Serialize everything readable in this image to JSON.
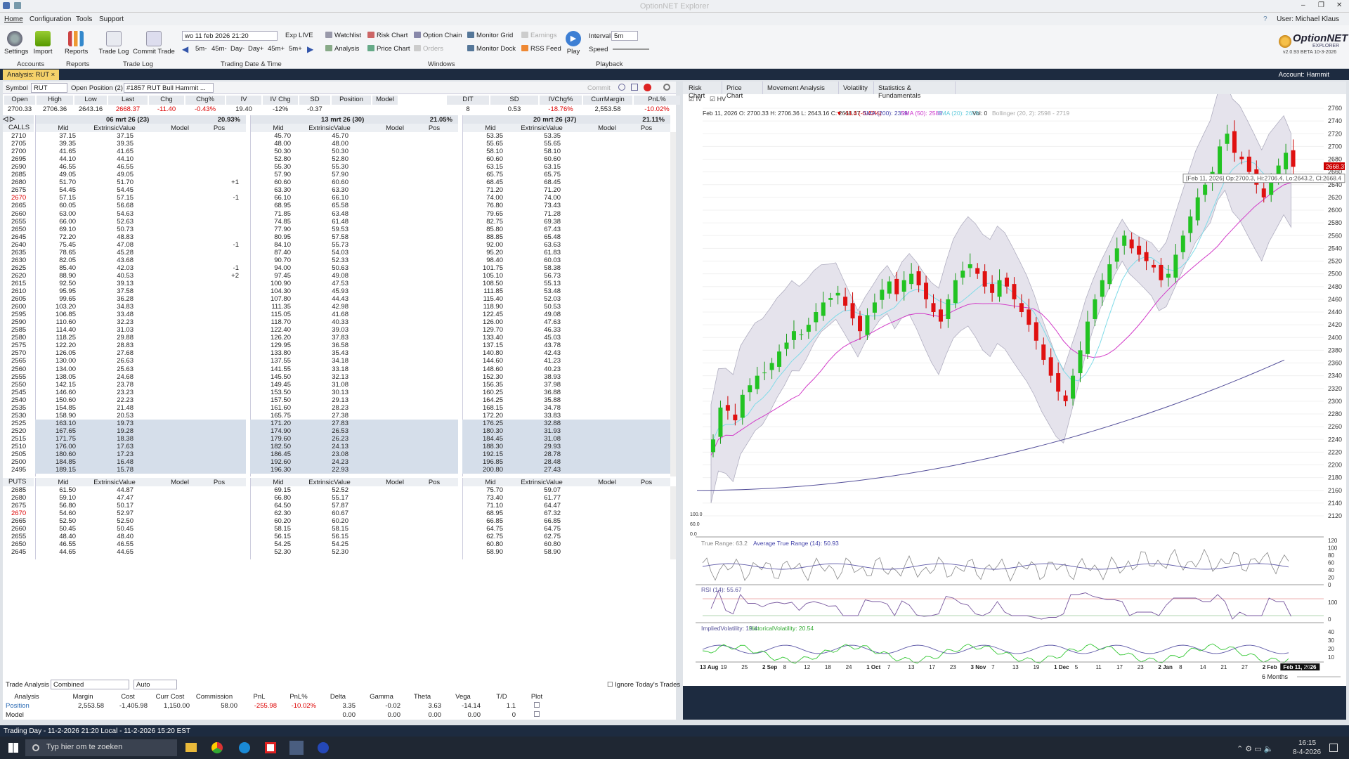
{
  "window": {
    "title": "OptionNET Explorer",
    "user": "User: Michael Klaus"
  },
  "menu": [
    "Home",
    "Configuration",
    "Tools",
    "Support"
  ],
  "ribbon": {
    "accounts": {
      "group": "Accounts",
      "buttons": [
        "Settings",
        "Import"
      ]
    },
    "reports": {
      "group": "Reports",
      "buttons": [
        "Reports"
      ]
    },
    "tradelog": {
      "group": "Trade Log",
      "buttons": [
        "Trade Log",
        "Commit Trade"
      ]
    },
    "datetime": {
      "group": "Trading Date & Time",
      "value": "wo 11 feb 2026 21:20",
      "exp": "Exp LIVE",
      "steps": [
        "5m-",
        "45m-",
        "Day-",
        "Day+",
        "45m+",
        "5m+"
      ]
    },
    "windows": {
      "group": "Windows",
      "items": [
        "Watchlist",
        "Risk Chart",
        "Option Chain",
        "Monitor Grid",
        "Earnings",
        "Analysis",
        "Price Chart",
        "Orders",
        "Monitor Dock",
        "RSS Feed"
      ]
    },
    "playback": {
      "group": "Playback",
      "play": "Play",
      "interval_label": "Interval",
      "interval": "5m",
      "speed_label": "Speed"
    },
    "logo": "OptionNET",
    "logo_sub": "EXPLORER",
    "version": "v2.0.93 BETA 10-3-2026"
  },
  "doctab": {
    "label": "Analysis: RUT",
    "account": "Account: Hammit"
  },
  "symbolbar": {
    "symbol_label": "Symbol",
    "symbol": "RUT",
    "open_label": "Open Position (2)",
    "position": "#1857 RUT Bull Hammit ...",
    "commit": "Commit"
  },
  "quote": {
    "headers": [
      "Open",
      "High",
      "Low",
      "Last",
      "Chg",
      "Chg%",
      "IV",
      "IV Chg",
      "SD",
      "Position",
      "Model"
    ],
    "values": [
      "2700.33",
      "2706.36",
      "2643.16",
      "2668.37",
      "-11.40",
      "-0.43%",
      "19.40",
      "-12%",
      "-0.37",
      "",
      ""
    ],
    "headers2": [
      "DIT",
      "SD",
      "IVChg%",
      "CurrMargin",
      "PnL%"
    ],
    "values2": [
      "8",
      "0.53",
      "-18.76%",
      "2,553.58",
      "-10.02%"
    ]
  },
  "expirations": [
    {
      "label": "06 mrt 26 (23)",
      "iv": "20.93%"
    },
    {
      "label": "13 mrt 26 (30)",
      "iv": "21.05%"
    },
    {
      "label": "20 mrt 26 (37)",
      "iv": "21.11%"
    }
  ],
  "chain_cols": [
    "Mid",
    "ExtrinsicValue",
    "Model",
    "Pos"
  ],
  "calls_label": "CALLS",
  "puts_label": "PUTS",
  "calls": [
    [
      "2710",
      "37.15",
      "37.15",
      "",
      "45.70",
      "45.70",
      "",
      "53.35",
      "53.35",
      ""
    ],
    [
      "2705",
      "39.35",
      "39.35",
      "",
      "48.00",
      "48.00",
      "",
      "55.65",
      "55.65",
      ""
    ],
    [
      "2700",
      "41.65",
      "41.65",
      "",
      "50.30",
      "50.30",
      "",
      "58.10",
      "58.10",
      ""
    ],
    [
      "2695",
      "44.10",
      "44.10",
      "",
      "52.80",
      "52.80",
      "",
      "60.60",
      "60.60",
      ""
    ],
    [
      "2690",
      "46.55",
      "46.55",
      "",
      "55.30",
      "55.30",
      "",
      "63.15",
      "63.15",
      ""
    ],
    [
      "2685",
      "49.05",
      "49.05",
      "",
      "57.90",
      "57.90",
      "",
      "65.75",
      "65.75",
      ""
    ],
    [
      "2680",
      "51.70",
      "51.70",
      "+1",
      "60.60",
      "60.60",
      "",
      "68.45",
      "68.45",
      ""
    ],
    [
      "2675",
      "54.45",
      "54.45",
      "",
      "63.30",
      "63.30",
      "",
      "71.20",
      "71.20",
      ""
    ],
    [
      "2670",
      "57.15",
      "57.15",
      "-1",
      "66.10",
      "66.10",
      "",
      "74.00",
      "74.00",
      ""
    ],
    [
      "2665",
      "60.05",
      "56.68",
      "",
      "68.95",
      "65.58",
      "",
      "76.80",
      "73.43",
      ""
    ],
    [
      "2660",
      "63.00",
      "54.63",
      "",
      "71.85",
      "63.48",
      "",
      "79.65",
      "71.28",
      ""
    ],
    [
      "2655",
      "66.00",
      "52.63",
      "",
      "74.85",
      "61.48",
      "",
      "82.75",
      "69.38",
      ""
    ],
    [
      "2650",
      "69.10",
      "50.73",
      "",
      "77.90",
      "59.53",
      "",
      "85.80",
      "67.43",
      ""
    ],
    [
      "2645",
      "72.20",
      "48.83",
      "",
      "80.95",
      "57.58",
      "",
      "88.85",
      "65.48",
      ""
    ],
    [
      "2640",
      "75.45",
      "47.08",
      "-1",
      "84.10",
      "55.73",
      "",
      "92.00",
      "63.63",
      ""
    ],
    [
      "2635",
      "78.65",
      "45.28",
      "",
      "87.40",
      "54.03",
      "",
      "95.20",
      "61.83",
      ""
    ],
    [
      "2630",
      "82.05",
      "43.68",
      "",
      "90.70",
      "52.33",
      "",
      "98.40",
      "60.03",
      ""
    ],
    [
      "2625",
      "85.40",
      "42.03",
      "-1",
      "94.00",
      "50.63",
      "",
      "101.75",
      "58.38",
      ""
    ],
    [
      "2620",
      "88.90",
      "40.53",
      "+2",
      "97.45",
      "49.08",
      "",
      "105.10",
      "56.73",
      ""
    ],
    [
      "2615",
      "92.50",
      "39.13",
      "",
      "100.90",
      "47.53",
      "",
      "108.50",
      "55.13",
      ""
    ],
    [
      "2610",
      "95.95",
      "37.58",
      "",
      "104.30",
      "45.93",
      "",
      "111.85",
      "53.48",
      ""
    ],
    [
      "2605",
      "99.65",
      "36.28",
      "",
      "107.80",
      "44.43",
      "",
      "115.40",
      "52.03",
      ""
    ],
    [
      "2600",
      "103.20",
      "34.83",
      "",
      "111.35",
      "42.98",
      "",
      "118.90",
      "50.53",
      ""
    ],
    [
      "2595",
      "106.85",
      "33.48",
      "",
      "115.05",
      "41.68",
      "",
      "122.45",
      "49.08",
      ""
    ],
    [
      "2590",
      "110.60",
      "32.23",
      "",
      "118.70",
      "40.33",
      "",
      "126.00",
      "47.63",
      ""
    ],
    [
      "2585",
      "114.40",
      "31.03",
      "",
      "122.40",
      "39.03",
      "",
      "129.70",
      "46.33",
      ""
    ],
    [
      "2580",
      "118.25",
      "29.88",
      "",
      "126.20",
      "37.83",
      "",
      "133.40",
      "45.03",
      ""
    ],
    [
      "2575",
      "122.20",
      "28.83",
      "",
      "129.95",
      "36.58",
      "",
      "137.15",
      "43.78",
      ""
    ],
    [
      "2570",
      "126.05",
      "27.68",
      "",
      "133.80",
      "35.43",
      "",
      "140.80",
      "42.43",
      ""
    ],
    [
      "2565",
      "130.00",
      "26.63",
      "",
      "137.55",
      "34.18",
      "",
      "144.60",
      "41.23",
      ""
    ],
    [
      "2560",
      "134.00",
      "25.63",
      "",
      "141.55",
      "33.18",
      "",
      "148.60",
      "40.23",
      ""
    ],
    [
      "2555",
      "138.05",
      "24.68",
      "",
      "145.50",
      "32.13",
      "",
      "152.30",
      "38.93",
      ""
    ],
    [
      "2550",
      "142.15",
      "23.78",
      "",
      "149.45",
      "31.08",
      "",
      "156.35",
      "37.98",
      ""
    ],
    [
      "2545",
      "146.60",
      "23.23",
      "",
      "153.50",
      "30.13",
      "",
      "160.25",
      "36.88",
      ""
    ],
    [
      "2540",
      "150.60",
      "22.23",
      "",
      "157.50",
      "29.13",
      "",
      "164.25",
      "35.88",
      ""
    ],
    [
      "2535",
      "154.85",
      "21.48",
      "",
      "161.60",
      "28.23",
      "",
      "168.15",
      "34.78",
      ""
    ],
    [
      "2530",
      "158.90",
      "20.53",
      "",
      "165.75",
      "27.38",
      "",
      "172.20",
      "33.83",
      ""
    ],
    [
      "2525",
      "163.10",
      "19.73",
      "",
      "171.20",
      "27.83",
      "",
      "176.25",
      "32.88",
      ""
    ],
    [
      "2520",
      "167.65",
      "19.28",
      "",
      "174.90",
      "26.53",
      "",
      "180.30",
      "31.93",
      ""
    ],
    [
      "2515",
      "171.75",
      "18.38",
      "",
      "179.60",
      "26.23",
      "",
      "184.45",
      "31.08",
      ""
    ],
    [
      "2510",
      "176.00",
      "17.63",
      "",
      "182.50",
      "24.13",
      "",
      "188.30",
      "29.93",
      ""
    ],
    [
      "2505",
      "180.60",
      "17.23",
      "",
      "186.45",
      "23.08",
      "",
      "192.15",
      "28.78",
      ""
    ],
    [
      "2500",
      "184.85",
      "16.48",
      "",
      "192.60",
      "24.23",
      "",
      "196.85",
      "28.48",
      ""
    ],
    [
      "2495",
      "189.15",
      "15.78",
      "",
      "196.30",
      "22.93",
      "",
      "200.80",
      "27.43",
      ""
    ]
  ],
  "puts": [
    [
      "2685",
      "61.50",
      "44.87",
      "",
      "69.15",
      "52.52",
      "",
      "75.70",
      "59.07",
      ""
    ],
    [
      "2680",
      "59.10",
      "47.47",
      "",
      "66.80",
      "55.17",
      "",
      "73.40",
      "61.77",
      ""
    ],
    [
      "2675",
      "56.80",
      "50.17",
      "",
      "64.50",
      "57.87",
      "",
      "71.10",
      "64.47",
      ""
    ],
    [
      "2670",
      "54.60",
      "52.97",
      "",
      "62.30",
      "60.67",
      "",
      "68.95",
      "67.32",
      ""
    ],
    [
      "2665",
      "52.50",
      "52.50",
      "",
      "60.20",
      "60.20",
      "",
      "66.85",
      "66.85",
      ""
    ],
    [
      "2660",
      "50.45",
      "50.45",
      "",
      "58.15",
      "58.15",
      "",
      "64.75",
      "64.75",
      ""
    ],
    [
      "2655",
      "48.40",
      "48.40",
      "",
      "56.15",
      "56.15",
      "",
      "62.75",
      "62.75",
      ""
    ],
    [
      "2650",
      "46.55",
      "46.55",
      "",
      "54.25",
      "54.25",
      "",
      "60.80",
      "60.80",
      ""
    ],
    [
      "2645",
      "44.65",
      "44.65",
      "",
      "52.30",
      "52.30",
      "",
      "58.90",
      "58.90",
      ""
    ]
  ],
  "trade_analysis": {
    "label": "Trade Analysis",
    "mode": "Combined",
    "auto": "Auto",
    "ignore": "Ignore Today's Trades",
    "headers": [
      "Analysis",
      "Margin",
      "Cost",
      "Curr Cost",
      "Commission",
      "PnL",
      "PnL%",
      "Delta",
      "Gamma",
      "Theta",
      "Vega",
      "T/D",
      "Plot"
    ],
    "rows": [
      [
        "Position",
        "2,553.58",
        "-1,405.98",
        "1,150.00",
        "58.00",
        "-255.98",
        "-10.02%",
        "3.35",
        "-0.02",
        "3.63",
        "-14.14",
        "1.1",
        ""
      ],
      [
        "Model",
        "",
        "",
        "",
        "",
        "",
        "",
        "0.00",
        "0.00",
        "0.00",
        "0.00",
        "0",
        ""
      ]
    ]
  },
  "right_tabs": [
    "Risk Chart",
    "Price Chart",
    "Movement Analysis",
    "Volatility",
    "Statistics & Fundamentals"
  ],
  "chart_info": {
    "toggles": [
      "IV",
      "HV"
    ],
    "ohlc": "Feb 11, 2026  O: 2700.33  H: 2706.36  L: 2643.16  C: 2668.37",
    "chg": "▼ -11.4 (-0.43%)",
    "sma200": "SMA (200): 2359",
    "sma50": "SMA (50): 2588",
    "sma20": "SMA (20): 2658",
    "vol": "Vol: 0",
    "boll": "Bollinger (20, 2): 2598 - 2719",
    "tooltip": "[Feb 11, 2026] Op:2700.3, Hi:2706.4, Lo:2643.2, Cl:2668.4",
    "last": "2668.37",
    "atr_a": "True Range: 63.2",
    "atr_b": "Average True Range (14): 50.93",
    "rsi": "RSI (14): 55.67",
    "ivl": "ImpliedVolatility: 19.4",
    "hvl": "HistoricalVolatility: 20.54",
    "period": "6 Months"
  },
  "chart_data": {
    "type": "candlestick",
    "y_ticks": [
      2760,
      2740,
      2720,
      2700,
      2680,
      2660,
      2640,
      2620,
      2600,
      2580,
      2560,
      2540,
      2520,
      2500,
      2480,
      2460,
      2440,
      2420,
      2400,
      2380,
      2360,
      2340,
      2320,
      2300,
      2280,
      2260,
      2240,
      2220,
      2200,
      2180,
      2160,
      2140,
      2120
    ],
    "x_ticks": [
      "13 Aug",
      "19",
      "25",
      "2 Sep",
      "8",
      "12",
      "18",
      "24",
      "1 Oct",
      "7",
      "13",
      "17",
      "23",
      "3 Nov",
      "7",
      "13",
      "19",
      "1 Dec",
      "5",
      "11",
      "17",
      "23",
      "2 Jan",
      "8",
      "14",
      "21",
      "27",
      "2 Feb",
      "Feb 11, 2026",
      "18"
    ],
    "close_path": [
      2240,
      2290,
      2285,
      2270,
      2310,
      2325,
      2340,
      2345,
      2360,
      2378,
      2392,
      2410,
      2405,
      2420,
      2440,
      2455,
      2462,
      2470,
      2450,
      2430,
      2410,
      2435,
      2455,
      2475,
      2488,
      2468,
      2490,
      2500,
      2482,
      2460,
      2440,
      2425,
      2460,
      2490,
      2505,
      2515,
      2500,
      2480,
      2470,
      2490,
      2480,
      2460,
      2440,
      2420,
      2395,
      2365,
      2340,
      2315,
      2300,
      2340,
      2380,
      2425,
      2460,
      2490,
      2515,
      2540,
      2560,
      2540,
      2530,
      2520,
      2510,
      2490,
      2500,
      2530,
      2560,
      2590,
      2620,
      2640,
      2660,
      2700,
      2720,
      2690,
      2680,
      2660,
      2640,
      2620,
      2650,
      2670,
      2690,
      2668
    ],
    "atr_ticks": [
      120,
      100,
      80,
      60,
      40,
      20,
      0
    ],
    "rsi_ticks": [
      100,
      0
    ],
    "vol_ticks": [
      40,
      30,
      20,
      10
    ]
  },
  "taskbar": {
    "search": "Typ hier om te zoeken",
    "time": "16:15",
    "date": "8-4-2026"
  },
  "status": "Trading Day - 11-2-2026 21:20 Local - 11-2-2026 15:20 EST"
}
